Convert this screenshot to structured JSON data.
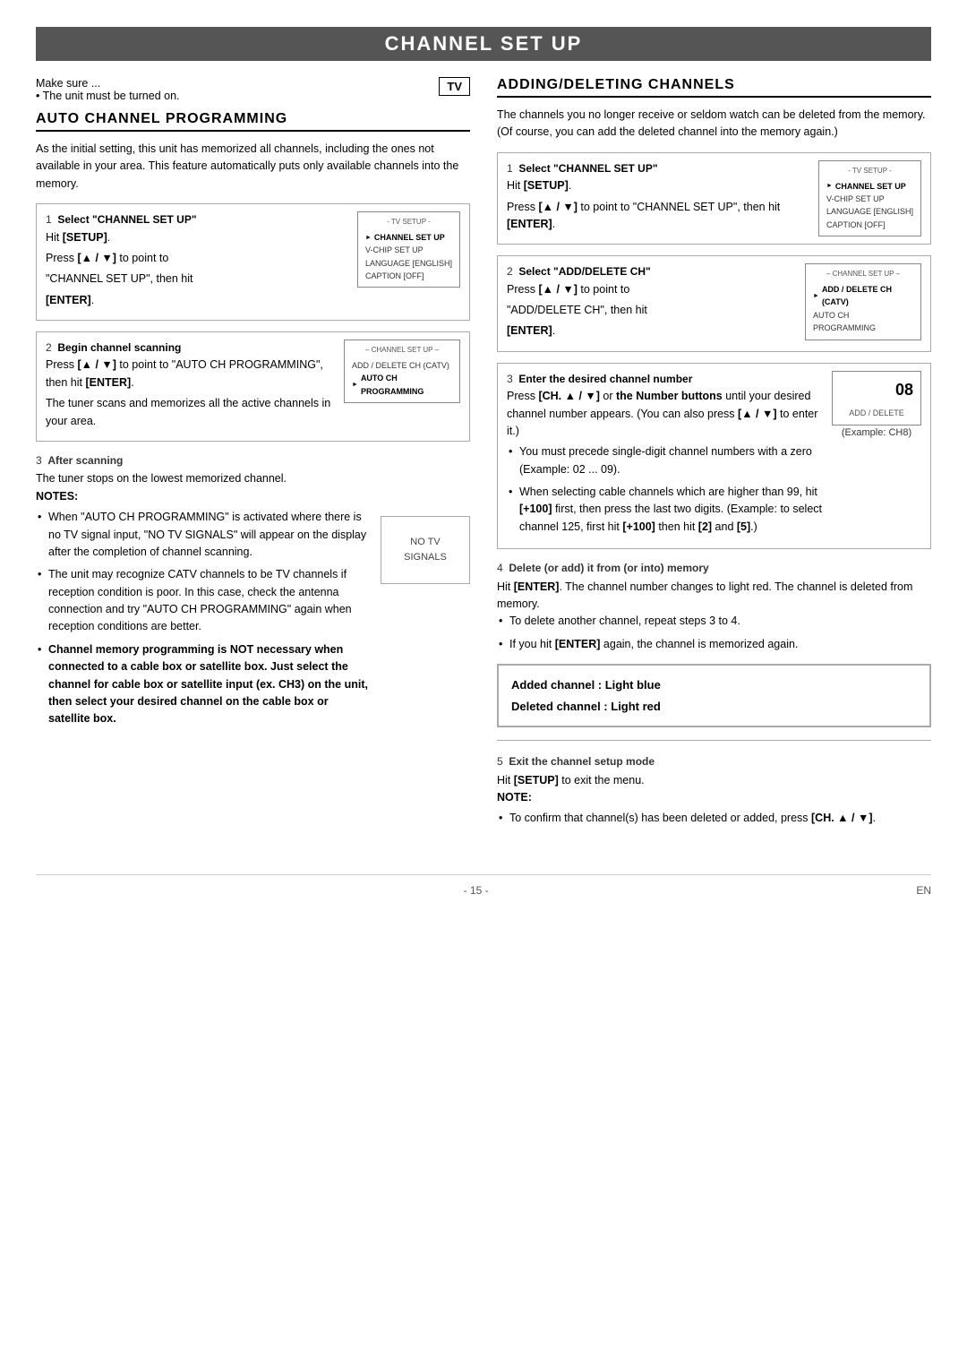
{
  "title": "CHANNEL SET UP",
  "left_column": {
    "make_sure": "Make sure ...",
    "make_sure_bullet": "The unit must be turned on.",
    "tv_badge": "TV",
    "auto_section_title": "AUTO CHANNEL PROGRAMMING",
    "auto_intro": "As the initial setting, this unit has memorized all channels, including the ones not available in your area. This feature automatically puts only available channels into the memory.",
    "step1": {
      "number": "1",
      "label": "Select \"CHANNEL SET UP\"",
      "lines": [
        "Hit [SETUP].",
        "Press [▲ / ▼] to point to",
        "\"CHANNEL SET UP\", then hit",
        "[ENTER]."
      ],
      "menu_title": "- TV SETUP -",
      "menu_items": [
        {
          "text": "CHANNEL SET UP",
          "selected": true
        },
        {
          "text": "V-CHIP SET UP",
          "selected": false
        },
        {
          "text": "LANGUAGE  [ENGLISH]",
          "selected": false
        },
        {
          "text": "CAPTION  [OFF]",
          "selected": false
        }
      ]
    },
    "step2": {
      "number": "2",
      "label": "Begin channel scanning",
      "lines": [
        "Press [▲ / ▼] to point to \"AUTO CH PROGRAMMING\", then hit [ENTER].",
        "The tuner scans and memorizes all the active channels in your area."
      ],
      "menu_title": "– CHANNEL SET UP –",
      "menu_items": [
        {
          "text": "ADD / DELETE CH (CATV)",
          "selected": false
        },
        {
          "text": "AUTO CH PROGRAMMING",
          "selected": true
        }
      ]
    },
    "step3": {
      "number": "3",
      "label": "After scanning",
      "after_scanning_text": "The tuner stops on the lowest memorized channel.",
      "notes_title": "NOTES:",
      "notes": [
        "When \"AUTO CH PROGRAMMING\" is activated where there is no TV signal input, \"NO TV SIGNALS\" will appear on the display after the completion of channel scanning.",
        "The unit may recognize CATV channels to be TV channels if reception condition is poor. In this case, check the antenna connection and try \"AUTO CH PROGRAMMING\" again when reception conditions are better.",
        "Channel memory programming is NOT necessary when connected to a cable box or satellite box. Just select the channel for cable box or satellite input (ex. CH3) on the unit, then select your desired channel on the cable box or satellite box."
      ],
      "signal_box_text": "NO  TV  SIGNALS"
    }
  },
  "right_column": {
    "adding_title": "ADDING/DELETING CHANNELS",
    "adding_intro": "The channels you no longer receive or seldom watch can be deleted from the memory. (Of course, you can add the deleted channel into the memory again.)",
    "step1": {
      "number": "1",
      "label": "Select \"CHANNEL SET UP\"",
      "lines": [
        "Hit [SETUP].",
        "Press [▲ / ▼] to point to \"CHANNEL SET UP\", then hit [ENTER]."
      ],
      "menu_title": "- TV SETUP -",
      "menu_items": [
        {
          "text": "CHANNEL SET UP",
          "selected": true
        },
        {
          "text": "V-CHIP SET UP",
          "selected": false
        },
        {
          "text": "LANGUAGE  [ENGLISH]",
          "selected": false
        },
        {
          "text": "CAPTION  [OFF]",
          "selected": false
        }
      ]
    },
    "step2": {
      "number": "2",
      "label": "Select \"ADD/DELETE CH\"",
      "lines": [
        "Press [▲ / ▼] to point to",
        "\"ADD/DELETE CH\", then hit",
        "[ENTER]."
      ],
      "menu_title": "– CHANNEL SET UP –",
      "menu_items": [
        {
          "text": "ADD / DELETE CH (CATV)",
          "selected": true
        },
        {
          "text": "AUTO CH PROGRAMMING",
          "selected": false
        }
      ]
    },
    "step3": {
      "number": "3",
      "label": "Enter the desired channel number",
      "lines": [
        "Press [CH. ▲ / ▼] or the Number buttons until your desired channel number appears. (You can also press [▲ / ▼] to enter it.)"
      ],
      "screen_num": "08",
      "screen_label": "ADD / DELETE",
      "example": "(Example: CH8)",
      "bullets": [
        "You must precede single-digit channel numbers with a zero (Example: 02 ... 09).",
        "When selecting cable channels which are higher than 99, hit [+100] first, then press the last two digits. (Example: to select channel 125, first hit [+100] then hit [2] and [5].)"
      ]
    },
    "step4": {
      "number": "4",
      "label": "Delete (or add) it from (or into) memory",
      "lines": [
        "Hit [ENTER]. The channel number changes to light red. The channel is deleted from memory."
      ],
      "bullets": [
        "To delete another channel, repeat steps 3 to 4.",
        "If you hit [ENTER] again, the channel is memorized again."
      ]
    },
    "channel_legend": {
      "added": "Added channel  : Light blue",
      "deleted": "Deleted channel : Light red"
    },
    "step5": {
      "number": "5",
      "label": "Exit the channel setup mode",
      "lines": [
        "Hit [SETUP] to exit the menu."
      ],
      "note_title": "NOTE:",
      "note_bullets": [
        "To confirm that channel(s) has been deleted or added, press [CH. ▲ / ▼]."
      ]
    }
  },
  "footer": {
    "page_number": "- 15 -",
    "lang": "EN"
  }
}
